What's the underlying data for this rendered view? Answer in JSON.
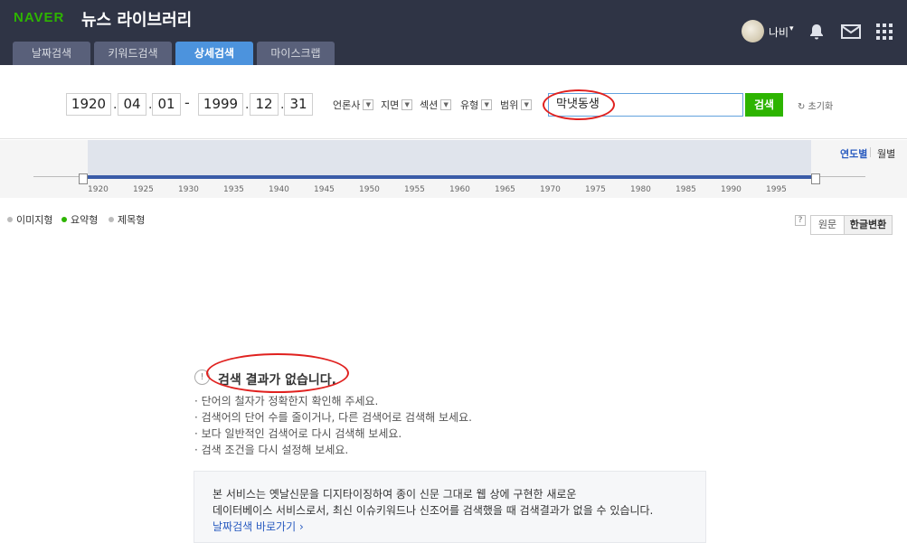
{
  "header": {
    "logo": "NAVER",
    "service_title": "뉴스 라이브러리",
    "tabs": [
      "날짜검색",
      "키워드검색",
      "상세검색",
      "마이스크랩"
    ],
    "active_tab": "상세검색",
    "user_name": "나비",
    "user_caret": "▾",
    "colors": {
      "background": "#2f3445",
      "active_tab": "#4c93dd",
      "logo": "#2db400"
    }
  },
  "search": {
    "start": {
      "year": "1920",
      "month": "04",
      "day": "01"
    },
    "end": {
      "year": "1999",
      "month": "12",
      "day": "31"
    },
    "dot": ".",
    "dash": "-",
    "filters": [
      "언론사",
      "지면",
      "섹션",
      "유형",
      "범위"
    ],
    "query": "막냇동생",
    "button_label": "검색",
    "reset_label": "↻ 초기화",
    "button_color": "#2db400"
  },
  "timeline": {
    "years": [
      "1920",
      "1925",
      "1930",
      "1935",
      "1940",
      "1945",
      "1950",
      "1955",
      "1960",
      "1965",
      "1970",
      "1975",
      "1980",
      "1985",
      "1990",
      "1995"
    ],
    "view_yearly": "연도별",
    "view_monthly": "월별"
  },
  "result_view": {
    "options": [
      "이미지형",
      "요약형",
      "제목형"
    ],
    "selected": "요약형",
    "help": "?",
    "toggle_original": "원문",
    "toggle_hangul": "한글변환"
  },
  "no_result": {
    "icon": "!",
    "title": "검색 결과가 없습니다.",
    "tips": [
      "· 단어의 철자가 정확한지 확인해 주세요.",
      "· 검색어의 단어 수를 줄이거나, 다른 검색어로 검색해 보세요.",
      "· 보다 일반적인 검색어로 다시 검색해 보세요.",
      "· 검색 조건을 다시 설정해 보세요."
    ]
  },
  "notice": {
    "line1": "본 서비스는 옛날신문을 디지타이징하여 종이 신문 그대로 웹 상에 구현한 새로운",
    "line2": "데이터베이스 서비스로서, 최신 이슈키워드나 신조어를 검색했을 때 검색결과가 없을 수 있습니다.",
    "link": "날짜검색 바로가기 ›"
  }
}
